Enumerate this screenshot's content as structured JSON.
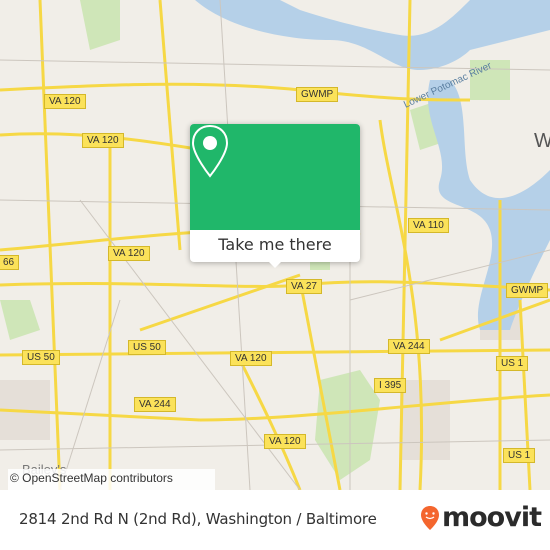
{
  "map": {
    "road_labels": [
      "VA 120",
      "VA 120",
      "VA 120",
      "VA 120",
      "VA 120",
      "GWMP",
      "VA 110",
      "66",
      "VA 27",
      "US 50",
      "US 50",
      "VA 244",
      "VA 244",
      "I 395",
      "US 1",
      "US 1",
      "GWMP"
    ],
    "place_labels": [
      "Lower Potomac River",
      "W",
      "Bailey's"
    ],
    "attribution": "© OpenStreetMap contributors",
    "colors": {
      "land": "#f1eee8",
      "water": "#b5d0e8",
      "road": "#f6d845",
      "park": "#cfe6b8"
    }
  },
  "popup": {
    "button_label": "Take me there",
    "icon": "map-pin-icon",
    "color": "#20b76a"
  },
  "footer": {
    "address": "2814 2nd Rd N (2nd Rd), Washington / Baltimore",
    "brand": "moovit",
    "brand_color": "#f4662e"
  }
}
